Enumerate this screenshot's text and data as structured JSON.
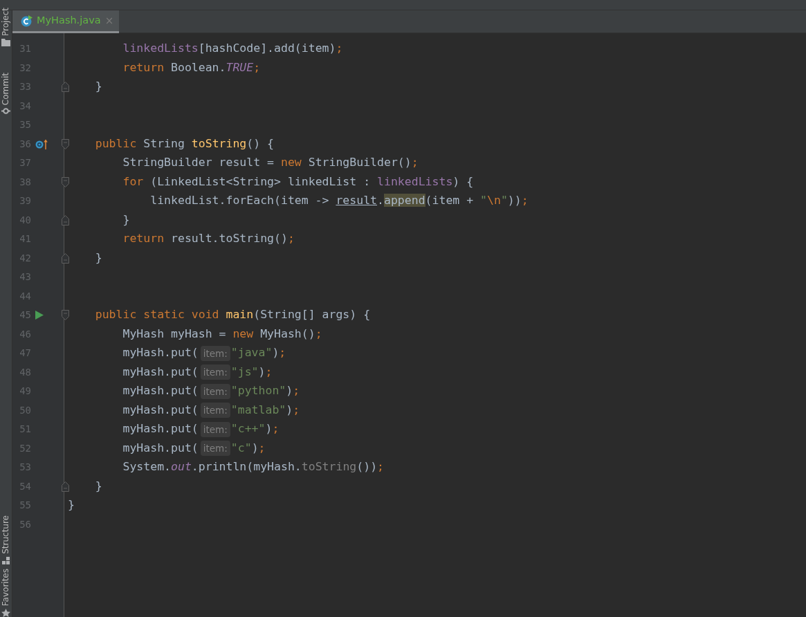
{
  "sidebar": {
    "items": [
      {
        "label": "Project"
      },
      {
        "label": "Commit"
      },
      {
        "label": "Structure"
      },
      {
        "label": "Favorites"
      }
    ]
  },
  "tabs": [
    {
      "label": "MyHash.java",
      "close": "×",
      "selected": true
    }
  ],
  "editor": {
    "lines": [
      {
        "number": "31",
        "override_marker": false,
        "run_marker": false,
        "fold_start": false,
        "fold_end": false,
        "tokens": [
          {
            "kind": "m",
            "text": "        linkedLists"
          },
          {
            "kind": "t",
            "text": "[hashCode].add(item)"
          },
          {
            "kind": "k",
            "text": ";"
          }
        ]
      },
      {
        "number": "32",
        "override_marker": false,
        "run_marker": false,
        "fold_start": false,
        "fold_end": false,
        "tokens": [
          {
            "kind": "k",
            "text": "        return"
          },
          {
            "kind": "t",
            "text": " Boolean."
          },
          {
            "kind": "i",
            "text": "TRUE"
          },
          {
            "kind": "k",
            "text": ";"
          }
        ]
      },
      {
        "number": "33",
        "override_marker": false,
        "run_marker": false,
        "fold_start": false,
        "fold_end": true,
        "tokens": [
          {
            "kind": "t",
            "text": "    }"
          }
        ]
      },
      {
        "number": "34",
        "override_marker": false,
        "run_marker": false,
        "fold_start": false,
        "fold_end": false
      },
      {
        "number": "35",
        "override_marker": false,
        "run_marker": false,
        "fold_start": false,
        "fold_end": false
      },
      {
        "number": "36",
        "override_marker": true,
        "run_marker": false,
        "fold_start": true,
        "fold_end": false,
        "tokens": [
          {
            "kind": "k",
            "text": "    public"
          },
          {
            "kind": "t",
            "text": " String "
          },
          {
            "kind": "f",
            "text": "toString"
          },
          {
            "kind": "t",
            "text": "() {"
          }
        ]
      },
      {
        "number": "37",
        "override_marker": false,
        "run_marker": false,
        "fold_start": false,
        "fold_end": false,
        "tokens": [
          {
            "kind": "t",
            "text": "        StringBuilder result = "
          },
          {
            "kind": "k",
            "text": "new"
          },
          {
            "kind": "t",
            "text": " StringBuilder()"
          },
          {
            "kind": "k",
            "text": ";"
          }
        ]
      },
      {
        "number": "38",
        "override_marker": false,
        "run_marker": false,
        "fold_start": true,
        "fold_end": false,
        "tokens": [
          {
            "kind": "k",
            "text": "        for"
          },
          {
            "kind": "t",
            "text": " (LinkedList<String> linkedList : "
          },
          {
            "kind": "m",
            "text": "linkedLists"
          },
          {
            "kind": "t",
            "text": ") {"
          }
        ]
      },
      {
        "number": "39",
        "override_marker": false,
        "run_marker": false,
        "fold_start": false,
        "fold_end": false,
        "tokens": [
          {
            "kind": "t",
            "text": "            linkedList.forEach(item -> "
          },
          {
            "kind": "u",
            "text": "result"
          },
          {
            "kind": "t",
            "text": "."
          },
          {
            "kind": "a",
            "text": "append"
          },
          {
            "kind": "t",
            "text": "(item + "
          },
          {
            "kind": "s",
            "text": "\""
          },
          {
            "kind": "e",
            "text": "\\n"
          },
          {
            "kind": "s",
            "text": "\""
          },
          {
            "kind": "t",
            "text": "))"
          },
          {
            "kind": "k",
            "text": ";"
          }
        ]
      },
      {
        "number": "40",
        "override_marker": false,
        "run_marker": false,
        "fold_start": false,
        "fold_end": true,
        "tokens": [
          {
            "kind": "t",
            "text": "        }"
          }
        ]
      },
      {
        "number": "41",
        "override_marker": false,
        "run_marker": false,
        "fold_start": false,
        "fold_end": false,
        "tokens": [
          {
            "kind": "k",
            "text": "        return"
          },
          {
            "kind": "t",
            "text": " result.toString()"
          },
          {
            "kind": "k",
            "text": ";"
          }
        ]
      },
      {
        "number": "42",
        "override_marker": false,
        "run_marker": false,
        "fold_start": false,
        "fold_end": true,
        "tokens": [
          {
            "kind": "t",
            "text": "    }"
          }
        ]
      },
      {
        "number": "43",
        "override_marker": false,
        "run_marker": false,
        "fold_start": false,
        "fold_end": false
      },
      {
        "number": "44",
        "override_marker": false,
        "run_marker": false,
        "fold_start": false,
        "fold_end": false
      },
      {
        "number": "45",
        "override_marker": false,
        "run_marker": true,
        "fold_start": true,
        "fold_end": false,
        "tokens": [
          {
            "kind": "k",
            "text": "    public static void "
          },
          {
            "kind": "f",
            "text": "main"
          },
          {
            "kind": "t",
            "text": "(String[] args) {"
          }
        ]
      },
      {
        "number": "46",
        "override_marker": false,
        "run_marker": false,
        "fold_start": false,
        "fold_end": false,
        "tokens": [
          {
            "kind": "t",
            "text": "        MyHash myHash = "
          },
          {
            "kind": "k",
            "text": "new"
          },
          {
            "kind": "t",
            "text": " MyHash()"
          },
          {
            "kind": "k",
            "text": ";"
          }
        ]
      },
      {
        "number": "47",
        "override_marker": false,
        "run_marker": false,
        "fold_start": false,
        "fold_end": false,
        "tokens": [
          {
            "kind": "t",
            "text": "        myHash.put("
          },
          {
            "kind": "h",
            "text": "item:"
          },
          {
            "kind": "s",
            "text": "\"java\""
          },
          {
            "kind": "t",
            "text": ")"
          },
          {
            "kind": "k",
            "text": ";"
          }
        ]
      },
      {
        "number": "48",
        "override_marker": false,
        "run_marker": false,
        "fold_start": false,
        "fold_end": false,
        "tokens": [
          {
            "kind": "t",
            "text": "        myHash.put("
          },
          {
            "kind": "h",
            "text": "item:"
          },
          {
            "kind": "s",
            "text": "\"js\""
          },
          {
            "kind": "t",
            "text": ")"
          },
          {
            "kind": "k",
            "text": ";"
          }
        ]
      },
      {
        "number": "49",
        "override_marker": false,
        "run_marker": false,
        "fold_start": false,
        "fold_end": false,
        "tokens": [
          {
            "kind": "t",
            "text": "        myHash.put("
          },
          {
            "kind": "h",
            "text": "item:"
          },
          {
            "kind": "s",
            "text": "\"python\""
          },
          {
            "kind": "t",
            "text": ")"
          },
          {
            "kind": "k",
            "text": ";"
          }
        ]
      },
      {
        "number": "50",
        "override_marker": false,
        "run_marker": false,
        "fold_start": false,
        "fold_end": false,
        "tokens": [
          {
            "kind": "t",
            "text": "        myHash.put("
          },
          {
            "kind": "h",
            "text": "item:"
          },
          {
            "kind": "s",
            "text": "\"matlab\""
          },
          {
            "kind": "t",
            "text": ")"
          },
          {
            "kind": "k",
            "text": ";"
          }
        ]
      },
      {
        "number": "51",
        "override_marker": false,
        "run_marker": false,
        "fold_start": false,
        "fold_end": false,
        "tokens": [
          {
            "kind": "t",
            "text": "        myHash.put("
          },
          {
            "kind": "h",
            "text": "item:"
          },
          {
            "kind": "s",
            "text": "\"c++\""
          },
          {
            "kind": "t",
            "text": ")"
          },
          {
            "kind": "k",
            "text": ";"
          }
        ]
      },
      {
        "number": "52",
        "override_marker": false,
        "run_marker": false,
        "fold_start": false,
        "fold_end": false,
        "tokens": [
          {
            "kind": "t",
            "text": "        myHash.put("
          },
          {
            "kind": "h",
            "text": "item:"
          },
          {
            "kind": "s",
            "text": "\"c\""
          },
          {
            "kind": "t",
            "text": ")"
          },
          {
            "kind": "k",
            "text": ";"
          }
        ]
      },
      {
        "number": "53",
        "override_marker": false,
        "run_marker": false,
        "fold_start": false,
        "fold_end": false,
        "tokens": [
          {
            "kind": "t",
            "text": "        System."
          },
          {
            "kind": "i",
            "text": "out"
          },
          {
            "kind": "t",
            "text": ".println(myHash."
          },
          {
            "kind": "d",
            "text": "toString"
          },
          {
            "kind": "t",
            "text": "())"
          },
          {
            "kind": "k",
            "text": ";"
          }
        ]
      },
      {
        "number": "54",
        "override_marker": false,
        "run_marker": false,
        "fold_start": false,
        "fold_end": true,
        "tokens": [
          {
            "kind": "t",
            "text": "    }"
          }
        ]
      },
      {
        "number": "55",
        "override_marker": false,
        "run_marker": false,
        "fold_start": false,
        "fold_end": false,
        "tokens": [
          {
            "kind": "t",
            "text": "}"
          }
        ]
      },
      {
        "number": "56",
        "override_marker": false,
        "run_marker": false,
        "fold_start": false,
        "fold_end": false
      }
    ]
  }
}
